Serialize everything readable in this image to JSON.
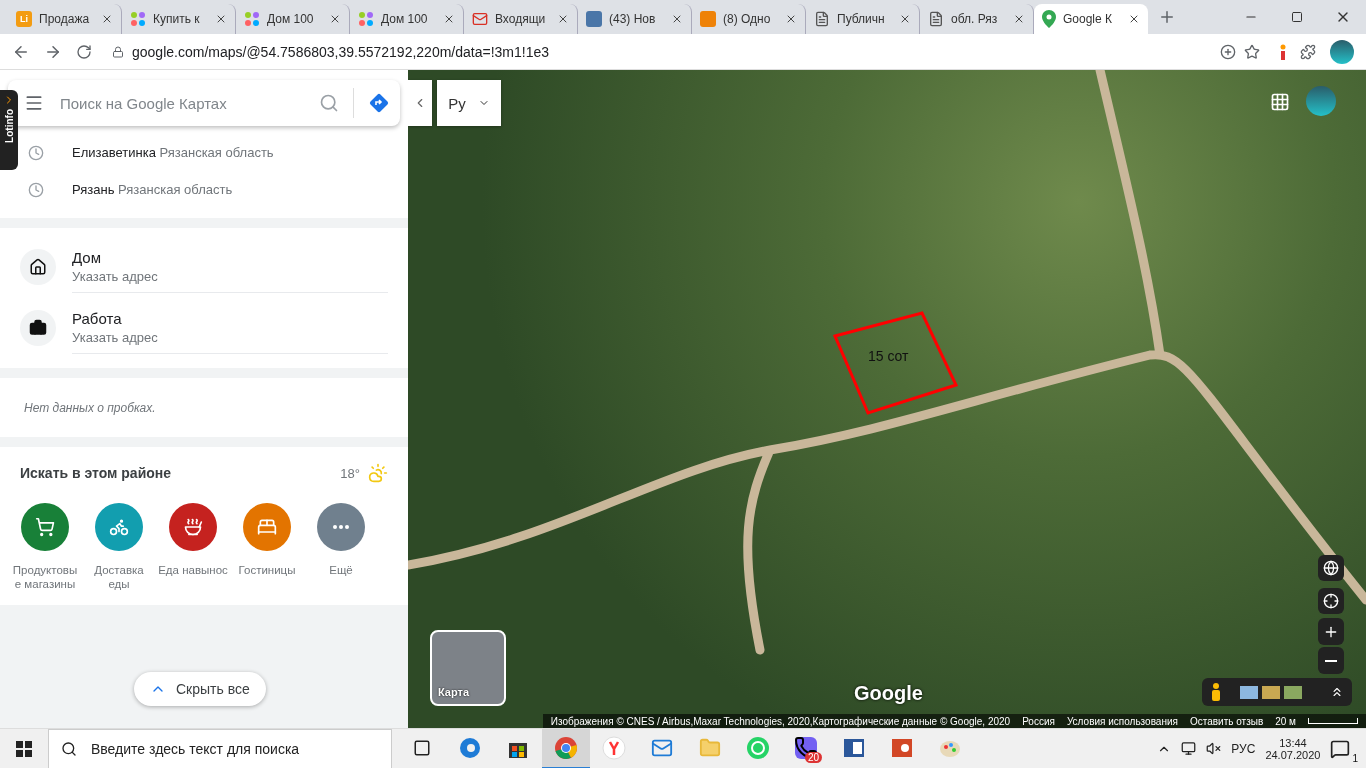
{
  "browser": {
    "tabs": [
      {
        "label": "Продажа",
        "kind": "letter",
        "icon_text": "Li",
        "selected": false
      },
      {
        "label": "Купить к",
        "kind": "dots",
        "selected": false
      },
      {
        "label": "Дом 100",
        "kind": "dots",
        "selected": false
      },
      {
        "label": "Дом 100",
        "kind": "dots",
        "selected": false
      },
      {
        "label": "Входящи",
        "kind": "mail",
        "selected": false
      },
      {
        "label": "(43) Нов",
        "kind": "vk",
        "selected": false
      },
      {
        "label": "(8) Одно",
        "kind": "ok",
        "selected": false
      },
      {
        "label": "Публичн",
        "kind": "doc",
        "selected": false
      },
      {
        "label": "обл. Ряз",
        "kind": "doc",
        "selected": false
      },
      {
        "label": "Google К",
        "kind": "maps",
        "selected": true
      }
    ],
    "address": "google.com/maps/@54.7586803,39.5572192,220m/data=!3m1!1e3"
  },
  "extension_tab": "Lotinfo",
  "sidebar": {
    "search": {
      "placeholder": "Поиск на Google Картах"
    },
    "recent": [
      {
        "name": "Елизаветинка",
        "region": "Рязанская область"
      },
      {
        "name": "Рязань",
        "region": "Рязанская область"
      }
    ],
    "places": [
      {
        "kind": "home",
        "title": "Дом",
        "subtitle": "Указать адрес"
      },
      {
        "kind": "work",
        "title": "Работа",
        "subtitle": "Указать адрес"
      }
    ],
    "traffic": "Нет данных о пробках.",
    "nearby": {
      "title": "Искать в этом районе",
      "temperature": "18°",
      "categories": [
        {
          "kind": "grocery",
          "label": "Продуктовы е магазины",
          "color": "#188038"
        },
        {
          "kind": "delivery",
          "label": "Доставка еды",
          "color": "#129eaf"
        },
        {
          "kind": "takeout",
          "label": "Еда навынос",
          "color": "#c5221f"
        },
        {
          "kind": "hotel",
          "label": "Гостиницы",
          "color": "#e37400"
        },
        {
          "kind": "more",
          "label": "Ещё",
          "color": "#70808e"
        }
      ]
    },
    "hide_button": "Скрыть все"
  },
  "map": {
    "language": "Ру",
    "plot_label": "15 сот",
    "layer_button": "Карта",
    "logo": "Google",
    "attribution": [
      "Изображения © CNES / Airbus,Maxar Technologies, 2020,Картографические данные © Google, 2020",
      "Россия",
      "Условия использования",
      "Оставить отзыв"
    ],
    "scale": "20 м"
  },
  "taskbar": {
    "search_placeholder": "Введите здесь текст для поиска",
    "apps": [
      {
        "kind": "taskview",
        "selected": false
      },
      {
        "kind": "edge",
        "selected": false
      },
      {
        "kind": "store",
        "selected": false
      },
      {
        "kind": "chrome",
        "selected": true
      },
      {
        "kind": "yandex",
        "selected": false
      },
      {
        "kind": "mail",
        "selected": false
      },
      {
        "kind": "explorer",
        "selected": false
      },
      {
        "kind": "whatsapp",
        "selected": false
      },
      {
        "kind": "viber",
        "selected": false,
        "badge": "20"
      },
      {
        "kind": "word",
        "selected": false
      },
      {
        "kind": "powerpoint",
        "selected": false
      },
      {
        "kind": "paint",
        "selected": false
      }
    ],
    "language": "РУС",
    "time": "13:44",
    "date": "24.07.2020",
    "notifications": "1"
  }
}
